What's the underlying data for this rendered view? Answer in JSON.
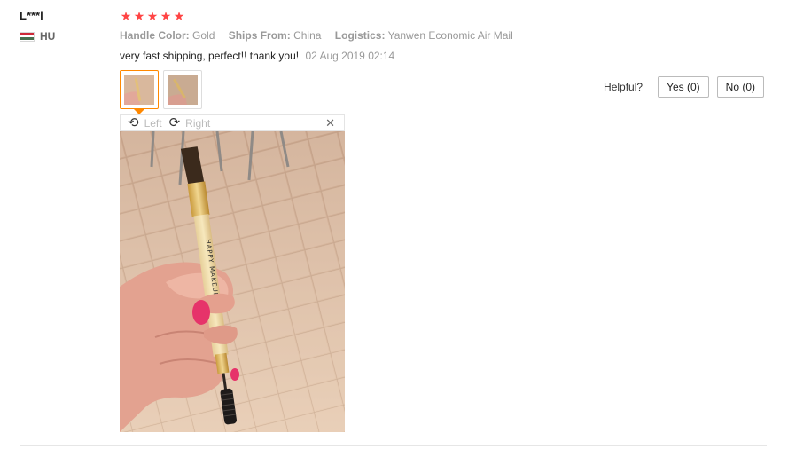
{
  "user": {
    "name": "L***l",
    "country": "HU"
  },
  "rating": {
    "stars": 5,
    "max": 5,
    "color": "#ff4747"
  },
  "properties": [
    {
      "label": "Handle Color:",
      "value": "Gold"
    },
    {
      "label": "Ships From:",
      "value": "China"
    },
    {
      "label": "Logistics:",
      "value": "Yanwen Economic Air Mail"
    }
  ],
  "review": {
    "text": "very fast shipping, perfect!! thank you!",
    "date": "02 Aug 2019 02:14"
  },
  "viewer": {
    "rotate_left": "Left",
    "rotate_right": "Right",
    "close": "✕",
    "image": "photo-makeup-brush-in-hand",
    "brush_text": "HAPPY MAKEUP"
  },
  "helpful": {
    "label": "Helpful?",
    "yes": "Yes (0)",
    "no": "No (0)"
  },
  "colors": {
    "accent": "#ff8800"
  }
}
